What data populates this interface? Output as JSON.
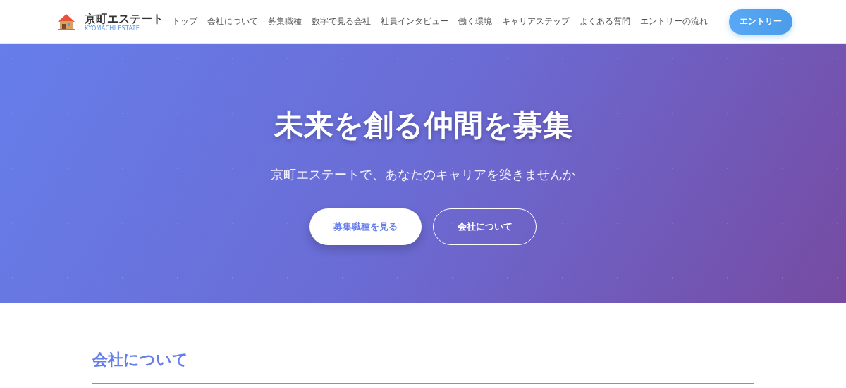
{
  "header": {
    "brand": {
      "name": "京町エステート",
      "subtitle": "KYOMACHI ESTATE"
    },
    "nav": [
      "トップ",
      "会社について",
      "募集職種",
      "数字で見る会社",
      "社員インタビュー",
      "働く環境",
      "キャリアステップ",
      "よくある質問",
      "エントリーの流れ"
    ],
    "entry_button": "エントリー"
  },
  "hero": {
    "title": "未来を創る仲間を募集",
    "subtitle": "京町エステートで、あなたのキャリアを築きませんか",
    "buttons": [
      {
        "label": "募集職種を見る",
        "kind": "primary"
      },
      {
        "label": "会社について",
        "kind": "outline"
      }
    ]
  },
  "section": {
    "heading": "会社について"
  }
}
